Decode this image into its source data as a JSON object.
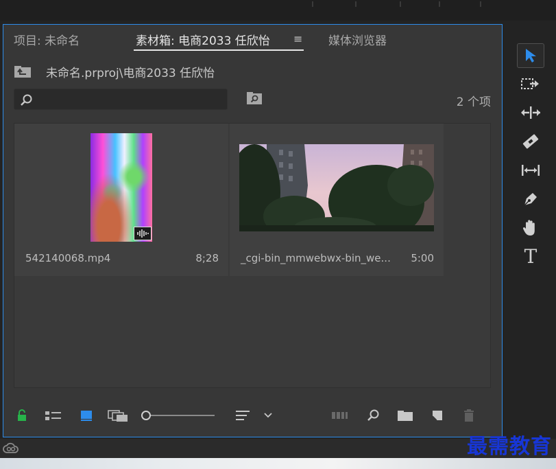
{
  "tabs": [
    {
      "label": "项目: 未命名",
      "active": false
    },
    {
      "label": "素材箱: 电商2033 任欣怡",
      "active": true
    },
    {
      "label": "媒体浏览器",
      "active": false
    }
  ],
  "tab_menu_glyph": "≡",
  "path": "未命名.prproj\\电商2033 任欣怡",
  "search": {
    "value": "",
    "placeholder": ""
  },
  "item_count": "2 个项",
  "items": [
    {
      "name": "542140068.mp4",
      "duration": "8;28",
      "has_audio_badge": true
    },
    {
      "name": "_cgi-bin_mmwebwx-bin_we...",
      "duration": "5:00",
      "has_audio_badge": false
    }
  ],
  "toolbar": {
    "zoom_level": 0.0
  },
  "tools": [
    "selection-tool",
    "track-select-forward-tool",
    "ripple-edit-tool",
    "razor-tool",
    "slip-tool",
    "pen-tool",
    "hand-tool",
    "type-tool"
  ],
  "type_tool_glyph": "T",
  "accent_color": "#2d8ceb",
  "watermark": "最需教育"
}
